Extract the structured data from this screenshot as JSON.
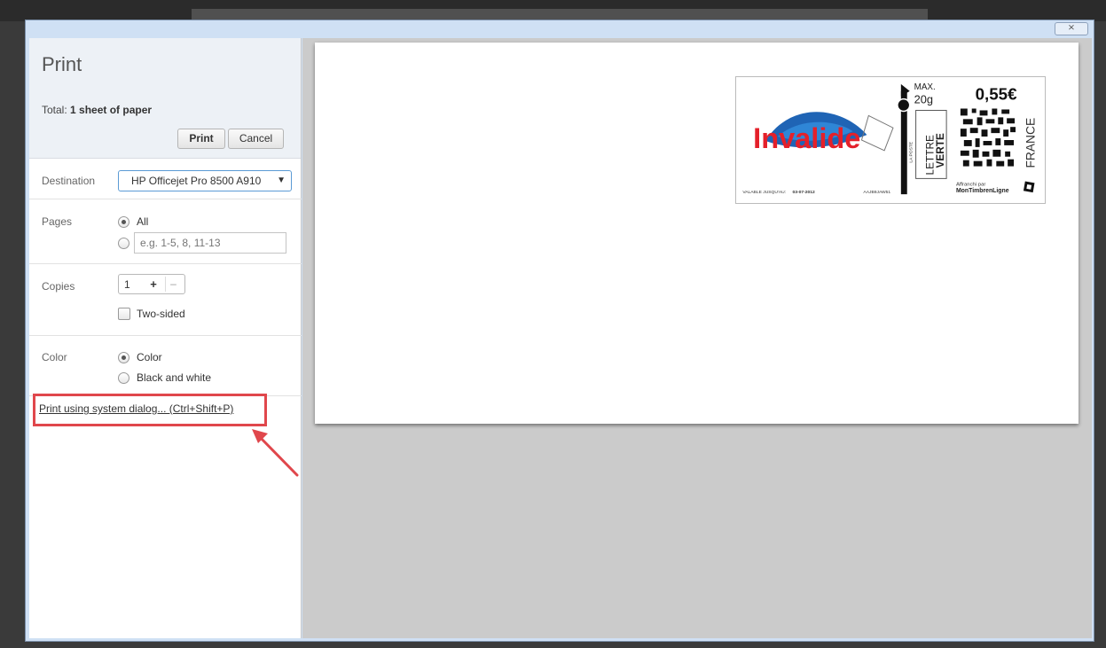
{
  "window": {
    "close_glyph": "⨯"
  },
  "sidebar": {
    "title": "Print",
    "total_prefix": "Total: ",
    "total_value": "1 sheet of paper",
    "print_button": "Print",
    "cancel_button": "Cancel",
    "destination": {
      "label": "Destination",
      "value": "HP Officejet Pro 8500 A910",
      "caret": "▼"
    },
    "pages": {
      "label": "Pages",
      "option_all": "All",
      "custom_placeholder": "e.g. 1-5, 8, 11-13",
      "selected": "All"
    },
    "copies": {
      "label": "Copies",
      "value": "1",
      "plus": "+",
      "minus": "–",
      "two_sided_label": "Two-sided",
      "two_sided_checked": false
    },
    "color": {
      "label": "Color",
      "option_color": "Color",
      "option_bw": "Black and white",
      "selected": "Color"
    },
    "system_dialog_link": "Print using system dialog... (Ctrl+Shift+P)"
  },
  "annotation": {
    "highlight_color": "#e0474c"
  },
  "stamp": {
    "max_label": "MAX.",
    "weight": "20g",
    "price": "0,55€",
    "watermark": "Invalide",
    "lettre": "LETTRE",
    "verte": "VERTE",
    "la_poste": "LA POSTE",
    "country": "FRANCE",
    "valid_until_label": "VALABLE JUSQU'AU:",
    "valid_until_date": "03-07-2012",
    "code": "AAJB9JAW51",
    "affranchi_label": "Affranchi par",
    "brand": "MonTimbrenLigne"
  }
}
